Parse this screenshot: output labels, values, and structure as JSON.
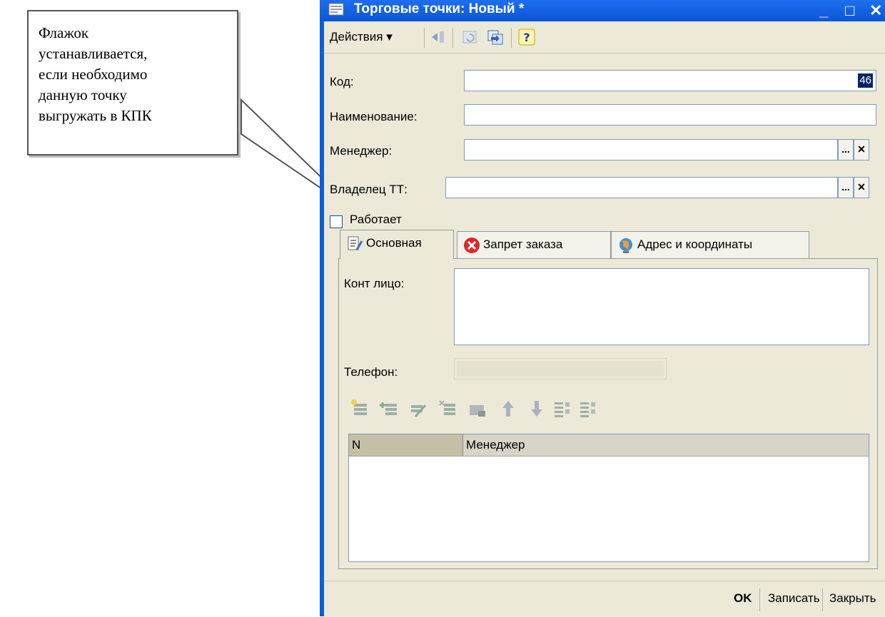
{
  "callout": {
    "text_lines": [
      "Флажок",
      "устанавливается,",
      "если необходимо",
      "данную точку",
      "выгружать в КПК"
    ]
  },
  "window": {
    "title": "Торговые точки: Новый *",
    "controls": {
      "minimize": "_",
      "maximize": "□",
      "close": "✕"
    }
  },
  "toolbar": {
    "actions_label": "Действия ▾",
    "icons": [
      "go-to-icon",
      "refresh-icon",
      "exchange-icon",
      "help-icon"
    ],
    "help_glyph": "?"
  },
  "form": {
    "code": {
      "label": "Код:",
      "value": "46"
    },
    "name": {
      "label": "Наименование:",
      "value": ""
    },
    "manager": {
      "label": "Менеджер:",
      "value": ""
    },
    "owner": {
      "label": "Владелец ТТ:",
      "value": ""
    },
    "select_glyph": "...",
    "clear_glyph": "✕"
  },
  "works_checkbox": {
    "label": "Работает",
    "checked": false
  },
  "tabs": [
    {
      "label": "Основная",
      "active": true,
      "icon": "document-icon"
    },
    {
      "label": "Запрет заказа",
      "active": false,
      "icon": "stop-icon"
    },
    {
      "label": "Адрес и координаты",
      "active": false,
      "icon": "globe-icon"
    }
  ],
  "main_tab": {
    "contact_label": "Конт лицо:",
    "contact_value": "",
    "phone_label": "Телефон:",
    "phone_value": "",
    "table": {
      "columns": [
        "N",
        "Менеджер"
      ],
      "rows": []
    },
    "table_toolbar_icons": [
      "add-row-icon",
      "copy-row-icon",
      "edit-row-icon",
      "delete-row-icon",
      "end-edit-icon",
      "move-up-icon",
      "move-down-icon",
      "sort-asc-icon",
      "sort-desc-icon"
    ]
  },
  "bottom_buttons": {
    "ok": "OK",
    "save": "Записать",
    "close": "Закрыть"
  },
  "colors": {
    "title_bar": "#0a5fd8",
    "window_bg": "#ece9d8",
    "selection": "#0a246a"
  }
}
